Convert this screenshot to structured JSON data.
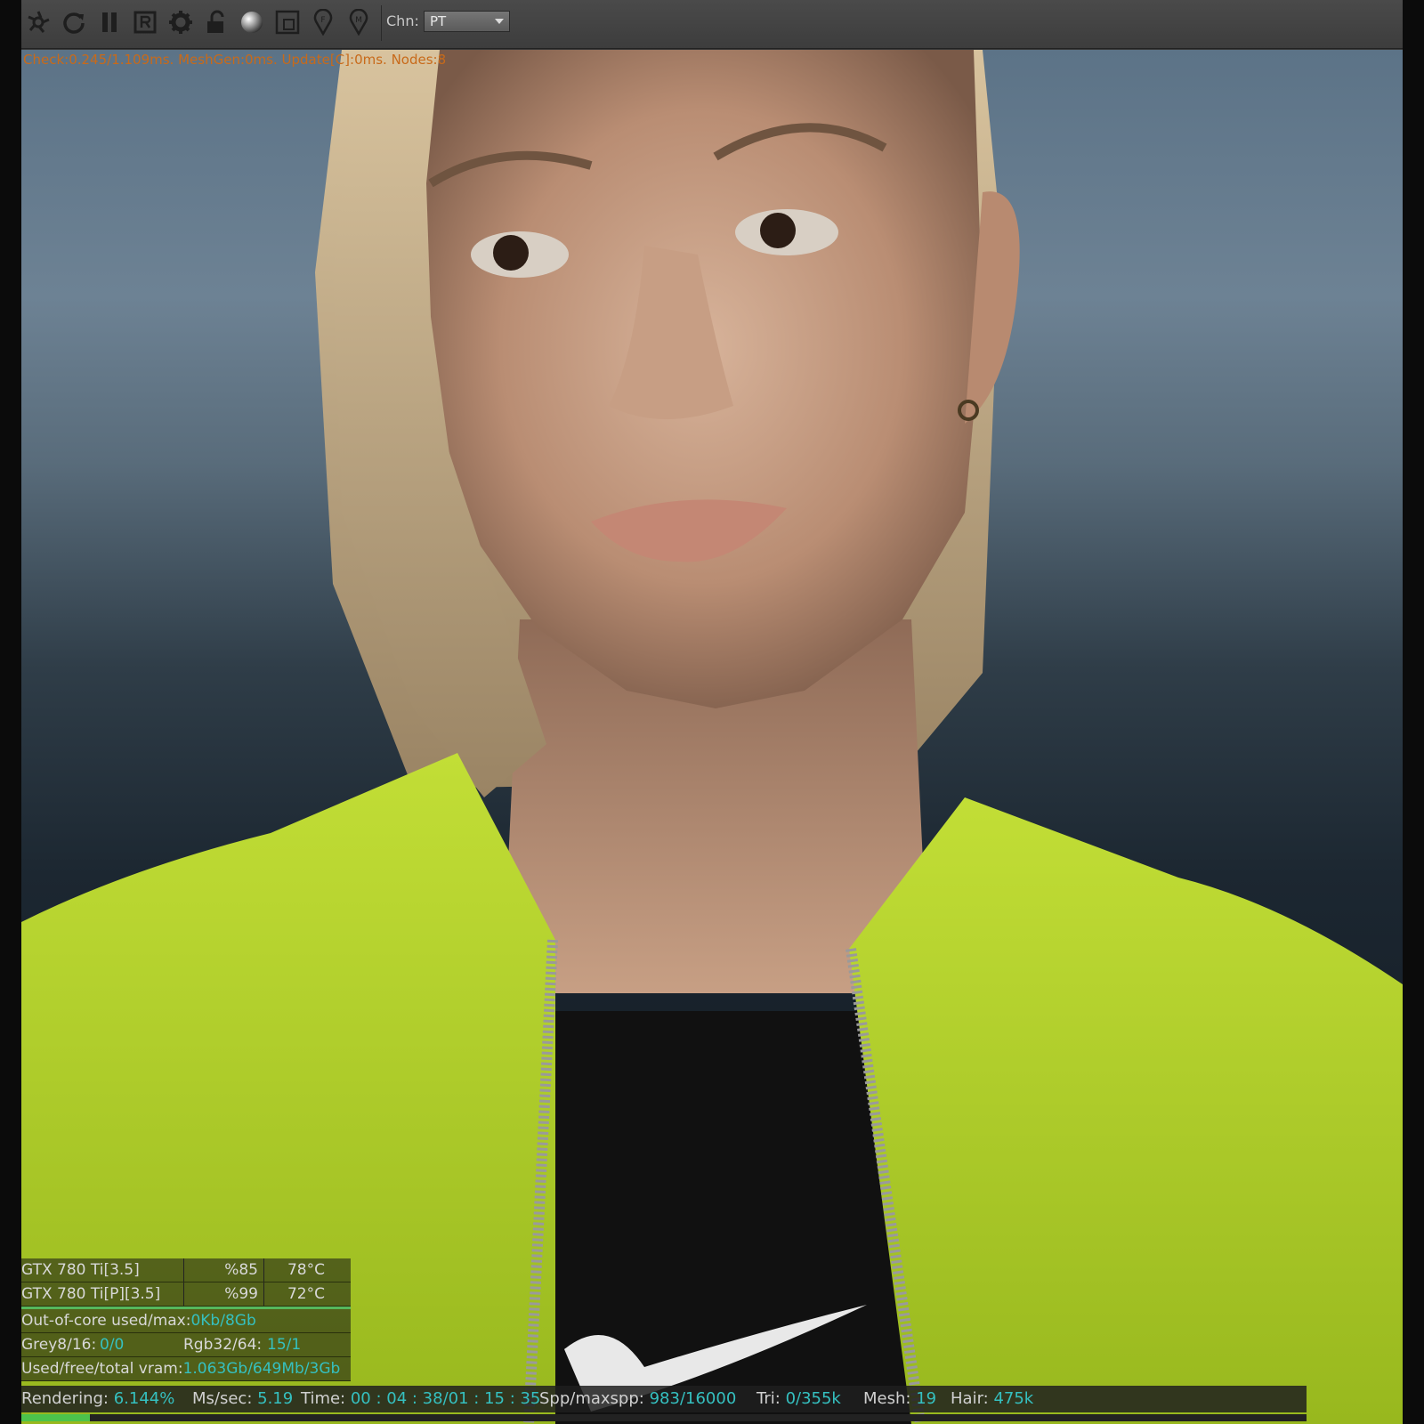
{
  "toolbar": {
    "icons": [
      "aperture-icon",
      "refresh-icon",
      "pause-icon",
      "r-box-icon",
      "gear-icon",
      "lock-icon",
      "sphere-icon",
      "region-icon",
      "pin-f-icon",
      "pin-m-icon"
    ],
    "chn_label": "Chn:",
    "chn_value": "PT"
  },
  "status_line": "Check:0.245/1.109ms. MeshGen:0ms. Update[C]:0ms. Nodes:8",
  "gpus": [
    {
      "name": "GTX 780 Ti[3.5]",
      "util": "%85",
      "temp": "78°C"
    },
    {
      "name": "GTX 780 Ti[P][3.5]",
      "util": "%99",
      "temp": "72°C"
    }
  ],
  "out_of_core": {
    "label": "Out-of-core used/max:",
    "value": "0Kb/8Gb"
  },
  "textures": {
    "grey_label": "Grey8/16:",
    "grey_value": "0/0",
    "rgb_label": "Rgb32/64:",
    "rgb_value": "15/1"
  },
  "vram": {
    "label": "Used/free/total vram:",
    "value": "1.063Gb/649Mb/3Gb"
  },
  "render": {
    "rendering_label": "Rendering:",
    "rendering_value": "6.144%",
    "progress": 0.0614,
    "ms_label": "Ms/sec:",
    "ms_value": "5.19",
    "time_label": "Time:",
    "time_value": "00 : 04 : 38/01 : 15 : 35",
    "spp_label": "Spp/maxspp:",
    "spp_value": "983/16000",
    "tri_label": "Tri:",
    "tri_value": "0/355k",
    "mesh_label": "Mesh:",
    "mesh_value": "19",
    "hair_label": "Hair:",
    "hair_value": "475k"
  },
  "colors": {
    "accent_value": "#35c0c0",
    "status_orange": "#c86a1a",
    "progress_green": "#4cc24c",
    "jacket": "#b2d12a"
  }
}
